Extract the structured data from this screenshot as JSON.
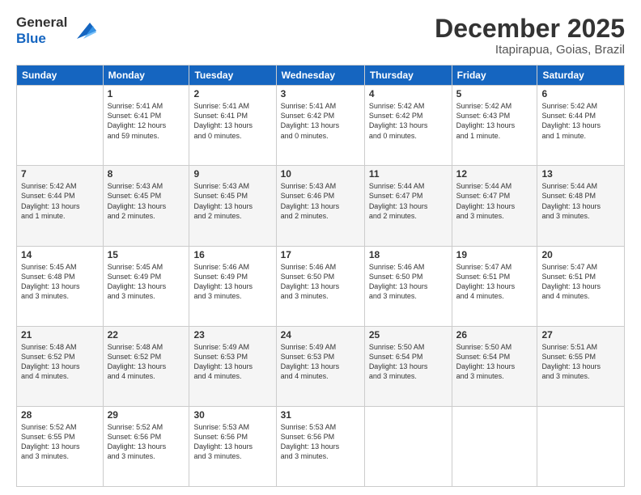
{
  "logo": {
    "line1": "General",
    "line2": "Blue"
  },
  "title": "December 2025",
  "subtitle": "Itapirapua, Goias, Brazil",
  "weekdays": [
    "Sunday",
    "Monday",
    "Tuesday",
    "Wednesday",
    "Thursday",
    "Friday",
    "Saturday"
  ],
  "weeks": [
    [
      {
        "day": "",
        "sunrise": "",
        "sunset": "",
        "daylight": ""
      },
      {
        "day": "1",
        "sunrise": "Sunrise: 5:41 AM",
        "sunset": "Sunset: 6:41 PM",
        "daylight": "Daylight: 12 hours and 59 minutes."
      },
      {
        "day": "2",
        "sunrise": "Sunrise: 5:41 AM",
        "sunset": "Sunset: 6:41 PM",
        "daylight": "Daylight: 13 hours and 0 minutes."
      },
      {
        "day": "3",
        "sunrise": "Sunrise: 5:41 AM",
        "sunset": "Sunset: 6:42 PM",
        "daylight": "Daylight: 13 hours and 0 minutes."
      },
      {
        "day": "4",
        "sunrise": "Sunrise: 5:42 AM",
        "sunset": "Sunset: 6:42 PM",
        "daylight": "Daylight: 13 hours and 0 minutes."
      },
      {
        "day": "5",
        "sunrise": "Sunrise: 5:42 AM",
        "sunset": "Sunset: 6:43 PM",
        "daylight": "Daylight: 13 hours and 1 minute."
      },
      {
        "day": "6",
        "sunrise": "Sunrise: 5:42 AM",
        "sunset": "Sunset: 6:44 PM",
        "daylight": "Daylight: 13 hours and 1 minute."
      }
    ],
    [
      {
        "day": "7",
        "sunrise": "Sunrise: 5:42 AM",
        "sunset": "Sunset: 6:44 PM",
        "daylight": "Daylight: 13 hours and 1 minute."
      },
      {
        "day": "8",
        "sunrise": "Sunrise: 5:43 AM",
        "sunset": "Sunset: 6:45 PM",
        "daylight": "Daylight: 13 hours and 2 minutes."
      },
      {
        "day": "9",
        "sunrise": "Sunrise: 5:43 AM",
        "sunset": "Sunset: 6:45 PM",
        "daylight": "Daylight: 13 hours and 2 minutes."
      },
      {
        "day": "10",
        "sunrise": "Sunrise: 5:43 AM",
        "sunset": "Sunset: 6:46 PM",
        "daylight": "Daylight: 13 hours and 2 minutes."
      },
      {
        "day": "11",
        "sunrise": "Sunrise: 5:44 AM",
        "sunset": "Sunset: 6:47 PM",
        "daylight": "Daylight: 13 hours and 2 minutes."
      },
      {
        "day": "12",
        "sunrise": "Sunrise: 5:44 AM",
        "sunset": "Sunset: 6:47 PM",
        "daylight": "Daylight: 13 hours and 3 minutes."
      },
      {
        "day": "13",
        "sunrise": "Sunrise: 5:44 AM",
        "sunset": "Sunset: 6:48 PM",
        "daylight": "Daylight: 13 hours and 3 minutes."
      }
    ],
    [
      {
        "day": "14",
        "sunrise": "Sunrise: 5:45 AM",
        "sunset": "Sunset: 6:48 PM",
        "daylight": "Daylight: 13 hours and 3 minutes."
      },
      {
        "day": "15",
        "sunrise": "Sunrise: 5:45 AM",
        "sunset": "Sunset: 6:49 PM",
        "daylight": "Daylight: 13 hours and 3 minutes."
      },
      {
        "day": "16",
        "sunrise": "Sunrise: 5:46 AM",
        "sunset": "Sunset: 6:49 PM",
        "daylight": "Daylight: 13 hours and 3 minutes."
      },
      {
        "day": "17",
        "sunrise": "Sunrise: 5:46 AM",
        "sunset": "Sunset: 6:50 PM",
        "daylight": "Daylight: 13 hours and 3 minutes."
      },
      {
        "day": "18",
        "sunrise": "Sunrise: 5:46 AM",
        "sunset": "Sunset: 6:50 PM",
        "daylight": "Daylight: 13 hours and 3 minutes."
      },
      {
        "day": "19",
        "sunrise": "Sunrise: 5:47 AM",
        "sunset": "Sunset: 6:51 PM",
        "daylight": "Daylight: 13 hours and 4 minutes."
      },
      {
        "day": "20",
        "sunrise": "Sunrise: 5:47 AM",
        "sunset": "Sunset: 6:51 PM",
        "daylight": "Daylight: 13 hours and 4 minutes."
      }
    ],
    [
      {
        "day": "21",
        "sunrise": "Sunrise: 5:48 AM",
        "sunset": "Sunset: 6:52 PM",
        "daylight": "Daylight: 13 hours and 4 minutes."
      },
      {
        "day": "22",
        "sunrise": "Sunrise: 5:48 AM",
        "sunset": "Sunset: 6:52 PM",
        "daylight": "Daylight: 13 hours and 4 minutes."
      },
      {
        "day": "23",
        "sunrise": "Sunrise: 5:49 AM",
        "sunset": "Sunset: 6:53 PM",
        "daylight": "Daylight: 13 hours and 4 minutes."
      },
      {
        "day": "24",
        "sunrise": "Sunrise: 5:49 AM",
        "sunset": "Sunset: 6:53 PM",
        "daylight": "Daylight: 13 hours and 4 minutes."
      },
      {
        "day": "25",
        "sunrise": "Sunrise: 5:50 AM",
        "sunset": "Sunset: 6:54 PM",
        "daylight": "Daylight: 13 hours and 3 minutes."
      },
      {
        "day": "26",
        "sunrise": "Sunrise: 5:50 AM",
        "sunset": "Sunset: 6:54 PM",
        "daylight": "Daylight: 13 hours and 3 minutes."
      },
      {
        "day": "27",
        "sunrise": "Sunrise: 5:51 AM",
        "sunset": "Sunset: 6:55 PM",
        "daylight": "Daylight: 13 hours and 3 minutes."
      }
    ],
    [
      {
        "day": "28",
        "sunrise": "Sunrise: 5:52 AM",
        "sunset": "Sunset: 6:55 PM",
        "daylight": "Daylight: 13 hours and 3 minutes."
      },
      {
        "day": "29",
        "sunrise": "Sunrise: 5:52 AM",
        "sunset": "Sunset: 6:56 PM",
        "daylight": "Daylight: 13 hours and 3 minutes."
      },
      {
        "day": "30",
        "sunrise": "Sunrise: 5:53 AM",
        "sunset": "Sunset: 6:56 PM",
        "daylight": "Daylight: 13 hours and 3 minutes."
      },
      {
        "day": "31",
        "sunrise": "Sunrise: 5:53 AM",
        "sunset": "Sunset: 6:56 PM",
        "daylight": "Daylight: 13 hours and 3 minutes."
      },
      {
        "day": "",
        "sunrise": "",
        "sunset": "",
        "daylight": ""
      },
      {
        "day": "",
        "sunrise": "",
        "sunset": "",
        "daylight": ""
      },
      {
        "day": "",
        "sunrise": "",
        "sunset": "",
        "daylight": ""
      }
    ]
  ]
}
